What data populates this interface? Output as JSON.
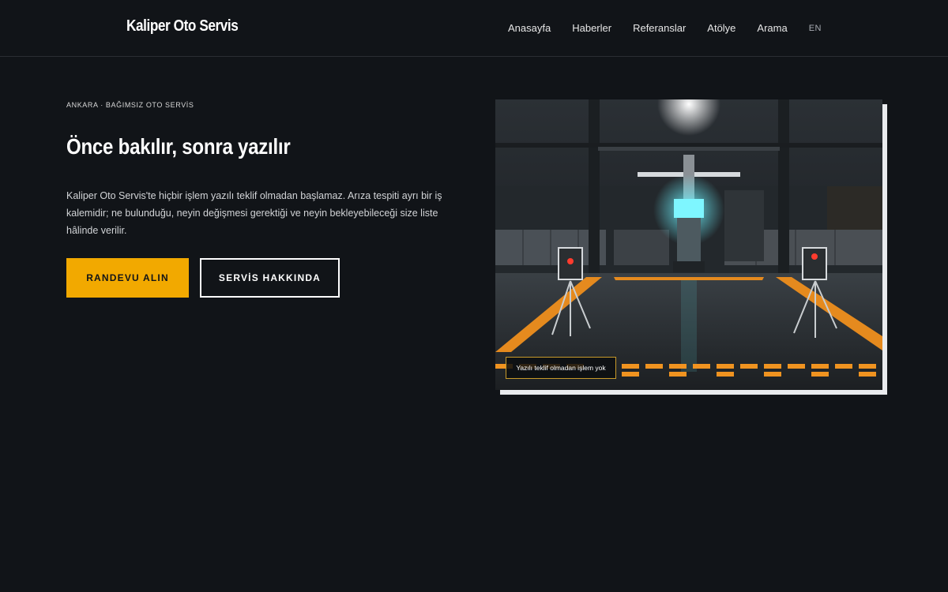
{
  "header": {
    "brand": "Kaliper Oto Servis",
    "nav": [
      "Anasayfa",
      "Haberler",
      "Referanslar",
      "Atölye",
      "Arama"
    ],
    "lang": "EN"
  },
  "hero": {
    "eyebrow": "ANKARA · BAĞIMSIZ OTO SERVİS",
    "headline": "Önce bakılır, sonra yazılır",
    "lead": "Kaliper Oto Servis'te hiçbir işlem yazılı teklif olmadan başlamaz. Arıza tespiti ayrı bir iş kalemidir; ne bulunduğu, neyin değişmesi gerektiği ve neyin bekleyebileceği size liste hâlinde verilir.",
    "primary_cta": "RANDEVU ALIN",
    "secondary_cta": "SERVİS HAKKINDA",
    "image_caption": "Yazılı teklif olmadan işlem yok"
  },
  "colors": {
    "background": "#111418",
    "accent": "#f2a900",
    "text": "#ffffff"
  },
  "icons": []
}
